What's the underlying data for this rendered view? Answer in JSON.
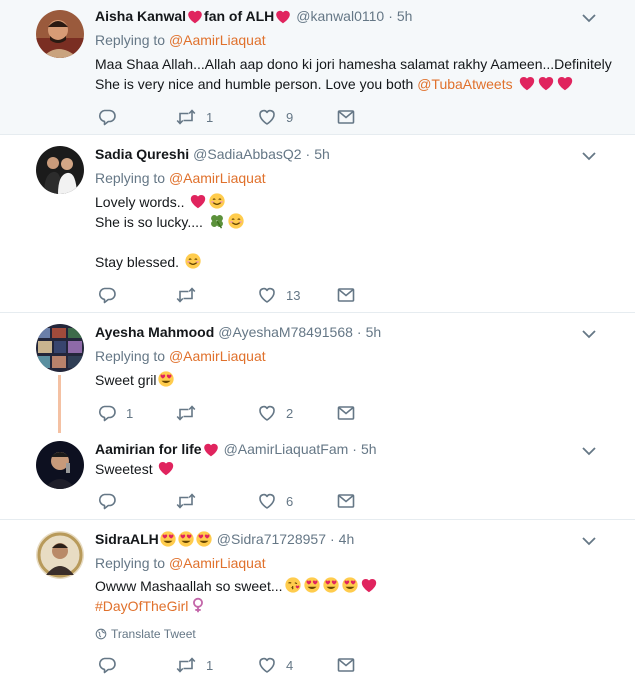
{
  "tweets": [
    {
      "name": "Aisha Kanwal",
      "name_suffix": "fan of ALH",
      "handle": "@kanwal0110",
      "time": "5h",
      "replying_prefix": "Replying to",
      "replying_to": "@AamirLiaquat",
      "line1": "Maa Shaa Allah...Allah aap dono ki jori hamesha salamat rakhy Aameen...Definitely",
      "line2": "She is very nice and humble person. Love you both",
      "line2_mention": "@TubaAtweets",
      "reply_count": "",
      "retweet_count": "1",
      "like_count": "9"
    },
    {
      "name": "Sadia Qureshi",
      "handle": "@SadiaAbbasQ2",
      "time": "5h",
      "replying_prefix": "Replying to",
      "replying_to": "@AamirLiaquat",
      "line1": "Lovely words..",
      "line2": "She is so lucky....",
      "line3": "Stay blessed.",
      "reply_count": "",
      "retweet_count": "",
      "like_count": "13"
    },
    {
      "name": "Ayesha Mahmood",
      "handle": "@AyeshaM78491568",
      "time": "5h",
      "replying_prefix": "Replying to",
      "replying_to": "@AamirLiaquat",
      "line1": "Sweet gril",
      "reply_count": "1",
      "retweet_count": "",
      "like_count": "2"
    },
    {
      "name": "Aamirian for life",
      "handle": "@AamirLiaquatFam",
      "time": "5h",
      "line1": "Sweetest",
      "reply_count": "",
      "retweet_count": "",
      "like_count": "6"
    },
    {
      "name": "SidraALH",
      "handle": "@Sidra71728957",
      "time": "4h",
      "replying_prefix": "Replying to",
      "replying_to": "@AamirLiaquat",
      "line1": "Owww Mashaallah so sweet...",
      "hashtag": "#DayOfTheGirl",
      "translate": "Translate Tweet",
      "reply_count": "",
      "retweet_count": "1",
      "like_count": "4"
    }
  ],
  "colors": {
    "accent": "#e0712c",
    "text": "#14171a",
    "muted": "#657786",
    "separator": "#e6ecf0",
    "highlight_bg": "#f5f8fa",
    "heart": "#e0245e"
  },
  "icons": [
    "reply-icon",
    "retweet-icon",
    "like-icon",
    "dm-icon",
    "chevron-down-icon",
    "globe-icon"
  ]
}
